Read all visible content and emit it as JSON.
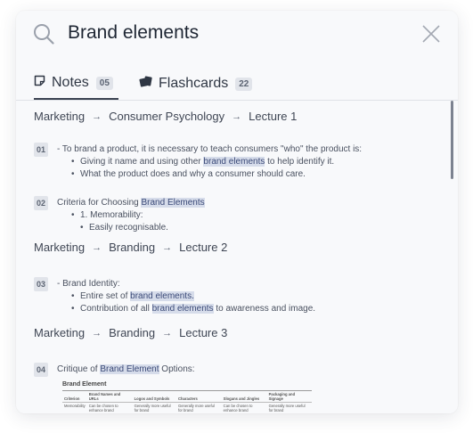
{
  "search": {
    "query": "Brand elements"
  },
  "tabs": [
    {
      "label": "Notes",
      "count": "05"
    },
    {
      "label": "Flashcards",
      "count": "22"
    }
  ],
  "results": [
    {
      "breadcrumb": [
        "Marketing",
        "Consumer Psychology",
        "Lecture 1"
      ],
      "notes": [
        {
          "number": "01",
          "line": "- To brand a product, it is necessary to teach consumers \"who\" the product is:",
          "bullets": [
            {
              "before": "Giving it name and using other ",
              "highlight": "brand elements",
              "after": " to help identify it."
            },
            {
              "before": "What the product does and why a consumer should care.",
              "highlight": "",
              "after": ""
            }
          ]
        },
        {
          "number": "02",
          "line_before": "Criteria for Choosing ",
          "line_highlight": "Brand Elements",
          "bullets": [
            {
              "text": "1. Memorability:"
            },
            {
              "text": "Easily recognisable."
            }
          ]
        }
      ]
    },
    {
      "breadcrumb": [
        "Marketing",
        "Branding",
        "Lecture 2"
      ],
      "notes": [
        {
          "number": "03",
          "line": "- Brand Identity:",
          "bullets": [
            {
              "before": "Entire set of ",
              "highlight": "brand elements.",
              "after": ""
            },
            {
              "before": "Contribution of all ",
              "highlight": "brand elements",
              "after": " to awareness and image."
            }
          ]
        }
      ]
    },
    {
      "breadcrumb": [
        "Marketing",
        "Branding",
        "Lecture 3"
      ],
      "notes": [
        {
          "number": "04",
          "line_before": "Critique of ",
          "line_highlight": "Brand Element",
          "line_after": " Options:"
        }
      ]
    }
  ],
  "table": {
    "title": "Brand Element",
    "headers": [
      "Criterion",
      "Brand Names and URLs",
      "Logos and Symbols",
      "Characters",
      "Slogans and Jingles",
      "Packaging and Signage"
    ],
    "row": [
      "Memorability",
      "Can be chosen to enhance brand",
      "Generally more useful for brand",
      "Generally more useful for brand",
      "Can be chosen to enhance brand",
      "Generally more useful for brand"
    ]
  },
  "icons": {
    "search": "search-icon",
    "close": "close-icon",
    "notes": "note-icon",
    "flashcards": "flashcards-icon"
  },
  "colors": {
    "highlight_bg": "#d6dcea",
    "highlight_text": "#3b4a78",
    "panel_bg": "#f8f9fb"
  }
}
